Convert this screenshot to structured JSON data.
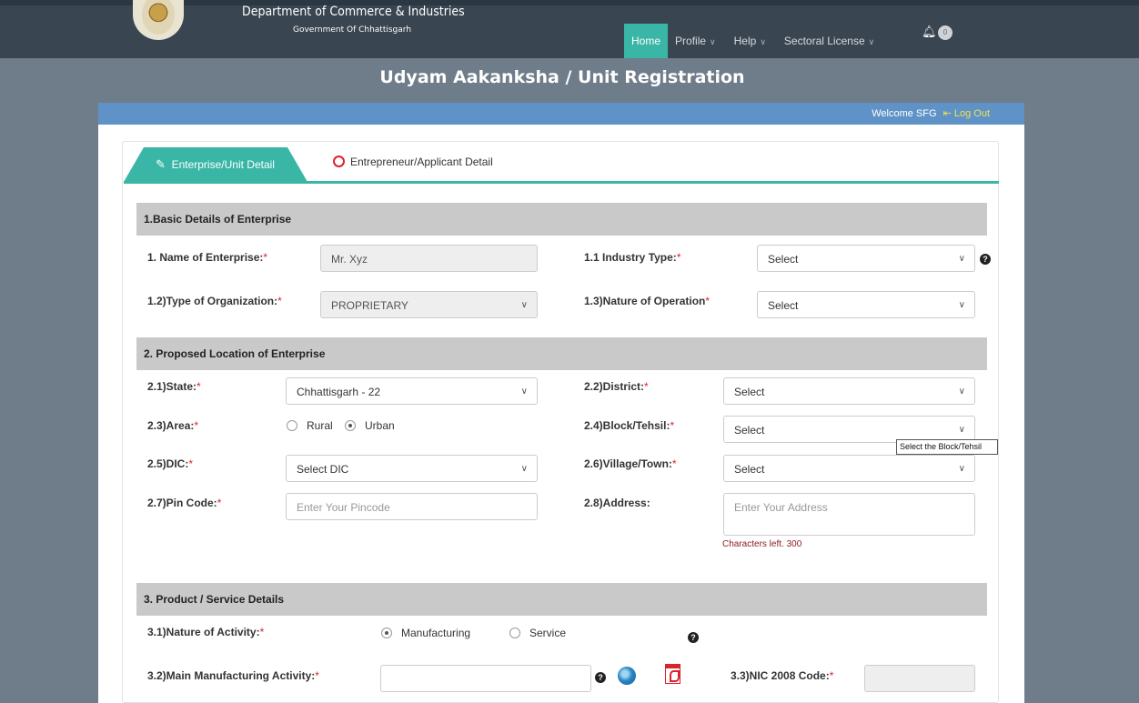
{
  "header": {
    "dept_title": "Department of Commerce & Industries",
    "dept_subtitle": "Government Of Chhattisgarh",
    "nav": [
      {
        "label": "Home"
      },
      {
        "label": "Profile"
      },
      {
        "label": "Help"
      },
      {
        "label": "Sectoral License"
      }
    ],
    "notifications_count": "0"
  },
  "page_title": "Udyam Aakanksha / Unit Registration",
  "welcome": {
    "text": "Welcome SFG",
    "logout": "Log Out"
  },
  "tabs": [
    {
      "label": "Enterprise/Unit Detail",
      "icon": "edit-icon"
    },
    {
      "label": "Entrepreneur/Applicant Detail",
      "icon": "clock-icon"
    }
  ],
  "sections": {
    "basic": "1.Basic Details of Enterprise",
    "location": "2. Proposed Location of Enterprise",
    "product": "3. Product / Service Details"
  },
  "basic": {
    "name_label": "1. Name of Enterprise:",
    "name_value": "Mr. Xyz",
    "industry_label": "1.1 Industry Type:",
    "industry_value": "Select",
    "org_label": "1.2)Type of Organization:",
    "org_value": "PROPRIETARY",
    "operation_label": "1.3)Nature of Operation",
    "operation_value": "Select"
  },
  "location": {
    "state_label": "2.1)State:",
    "state_value": "Chhattisgarh - 22",
    "district_label": "2.2)District:",
    "district_value": "Select",
    "area_label": "2.3)Area:",
    "area_options": [
      "Rural",
      "Urban"
    ],
    "area_selected": "Urban",
    "block_label": "2.4)Block/Tehsil:",
    "block_value": "Select",
    "block_tooltip": "Select the Block/Tehsil",
    "dic_label": "2.5)DIC:",
    "dic_value": "Select DIC",
    "village_label": "2.6)Village/Town:",
    "village_value": "Select",
    "pin_label": "2.7)Pin Code:",
    "pin_placeholder": "Enter Your Pincode",
    "address_label": "2.8)Address:",
    "address_placeholder": "Enter Your Address",
    "chars_left": "Characters left. 300"
  },
  "product": {
    "activity_label": "3.1)Nature of Activity:",
    "activity_options": [
      "Manufacturing",
      "Service"
    ],
    "activity_selected": "Manufacturing",
    "main_activity_label": "3.2)Main Manufacturing Activity:",
    "main_activity_value": "",
    "nic_label": "3.3)NIC 2008 Code:",
    "nic_value": ""
  },
  "required_mark": "*",
  "colors": {
    "accent": "#3ab6a6",
    "header_bg": "#394550",
    "welcome_bar": "#5f93c7",
    "required": "#d9232d"
  }
}
